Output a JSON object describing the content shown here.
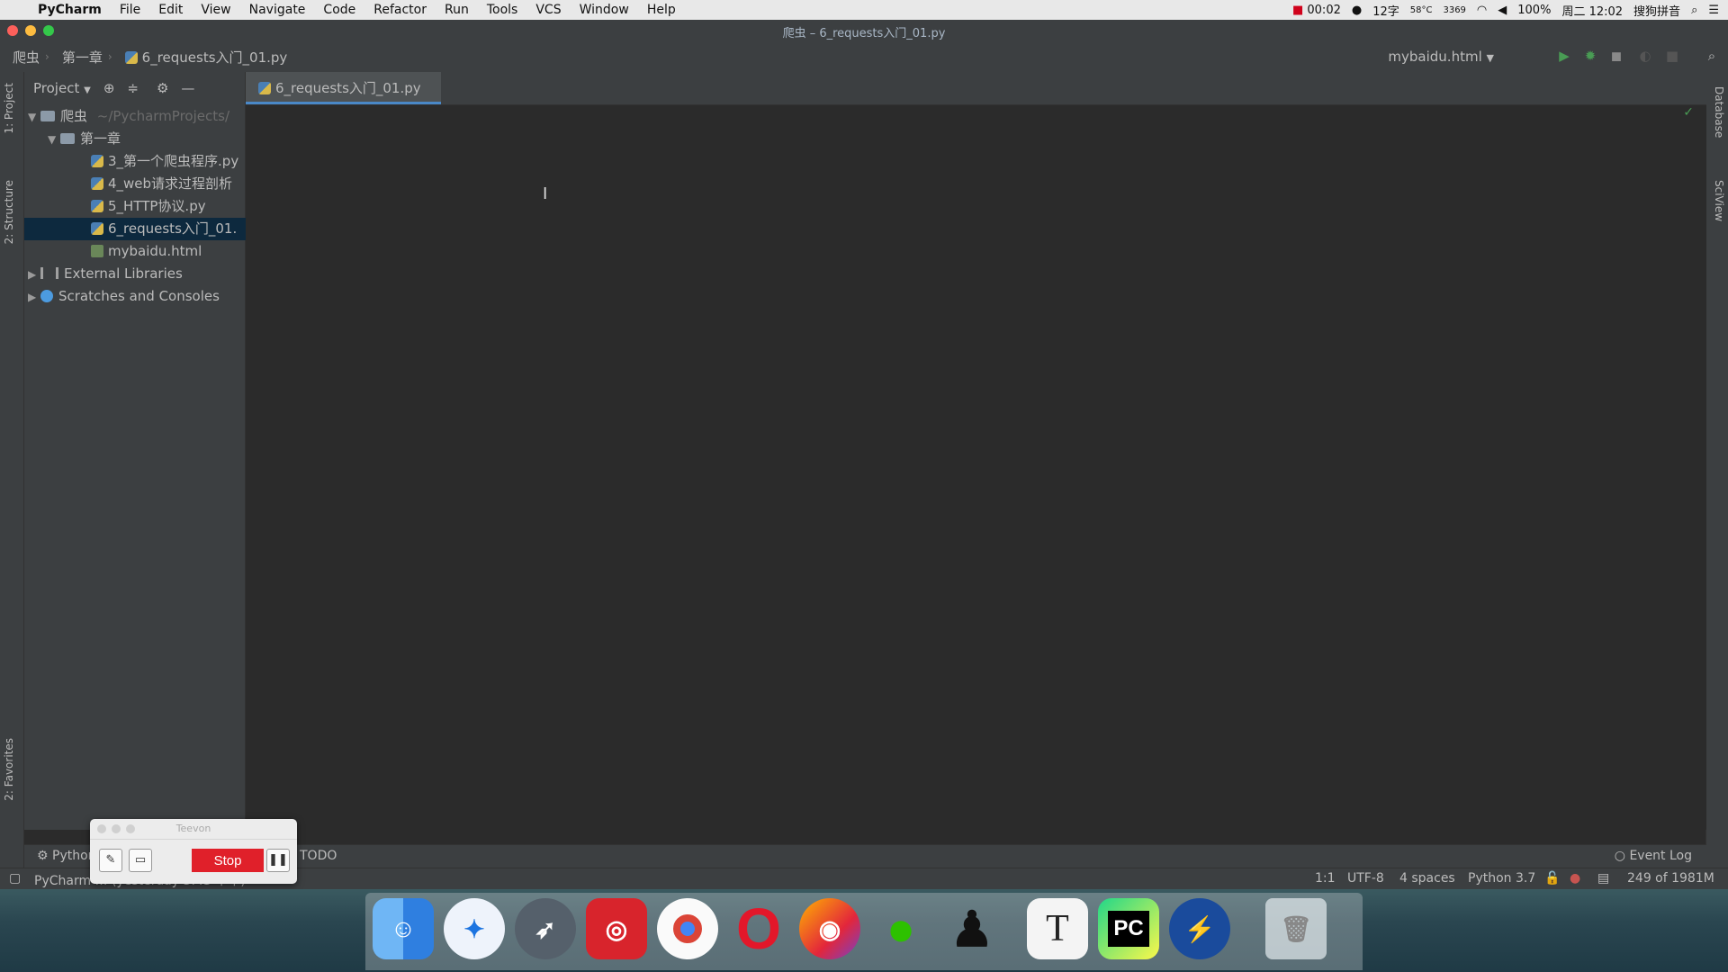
{
  "menubar": {
    "app_name": "PyCharm",
    "items": [
      "File",
      "Edit",
      "View",
      "Navigate",
      "Code",
      "Refactor",
      "Run",
      "Tools",
      "VCS",
      "Window",
      "Help"
    ],
    "status": {
      "record_time": "00:02",
      "calendar": "12字",
      "temp": "58°C",
      "rpm": "3369",
      "battery": "100%",
      "clock": "周二 12:02",
      "input_method": "搜狗拼音"
    }
  },
  "window": {
    "title": "爬虫 – 6_requests入门_01.py"
  },
  "navbar": {
    "breadcrumbs": [
      "爬虫",
      "第一章",
      "6_requests入门_01.py"
    ],
    "run_config": "mybaidu.html"
  },
  "left_stripe": {
    "tabs": [
      "1: Project",
      "2: Structure",
      "2: Favorites"
    ]
  },
  "right_stripe": {
    "tabs": [
      "Database",
      "SciView"
    ]
  },
  "project_panel": {
    "header": "Project",
    "tree": [
      {
        "label": "爬虫",
        "suffix": "~/PycharmProjects/",
        "level": 0,
        "type": "folder",
        "expanded": true
      },
      {
        "label": "第一章",
        "level": 1,
        "type": "folder",
        "expanded": true
      },
      {
        "label": "3_第一个爬虫程序.py",
        "level": 2,
        "type": "python"
      },
      {
        "label": "4_web请求过程剖析",
        "level": 2,
        "type": "python"
      },
      {
        "label": "5_HTTP协议.py",
        "level": 2,
        "type": "python"
      },
      {
        "label": "6_requests入门_01.",
        "level": 2,
        "type": "python",
        "selected": true
      },
      {
        "label": "mybaidu.html",
        "level": 2,
        "type": "html"
      },
      {
        "label": "External Libraries",
        "level": 0,
        "type": "library"
      },
      {
        "label": "Scratches and Consoles",
        "level": 0,
        "type": "scratch"
      }
    ]
  },
  "editor": {
    "active_tab": "6_requests入门_01.py"
  },
  "bottom_tools": {
    "left": "Python",
    "todo": "TODO",
    "event_log": "Event Log"
  },
  "statusbar": {
    "message": "PyCharm … (yesterday 3:43 下午)",
    "position": "1:1",
    "encoding": "UTF-8",
    "indent": "4 spaces",
    "interpreter": "Python 3.7",
    "memory": "249 of 1981M"
  },
  "recorder": {
    "title": "Teevon",
    "stop_label": "Stop"
  },
  "dock": {
    "apps": [
      "Finder",
      "Safari",
      "Launchpad",
      "NetEase Music",
      "Chrome",
      "Opera",
      "Firefox",
      "WeChat",
      "QQ",
      "Typora",
      "PyCharm",
      "Instastats",
      "Trash"
    ]
  },
  "colors": {
    "accent": "#4a88c7",
    "stop_button": "#e0202a",
    "editor_bg": "#2b2b2b",
    "panel_bg": "#3c3f41"
  }
}
